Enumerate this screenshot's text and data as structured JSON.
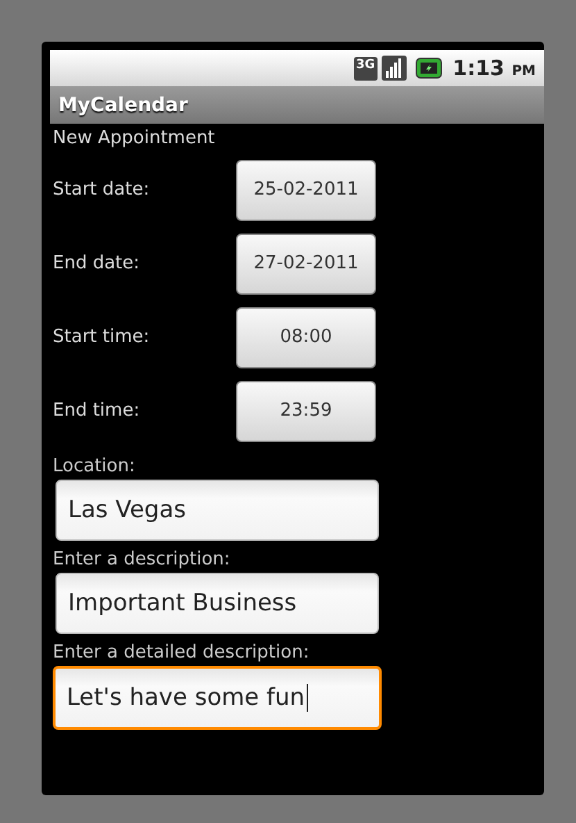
{
  "status_bar": {
    "network": "3G",
    "time": "1:13",
    "meridiem": "PM"
  },
  "app_title": "MyCalendar",
  "heading": "New Appointment",
  "pickers": [
    {
      "label": "Start date:",
      "value": "25-02-2011"
    },
    {
      "label": "End date:",
      "value": "27-02-2011"
    },
    {
      "label": "Start time:",
      "value": "08:00"
    },
    {
      "label": "End time:",
      "value": "23:59"
    }
  ],
  "fields": [
    {
      "label": "Location:",
      "value": "Las Vegas",
      "focused": false
    },
    {
      "label": "Enter a description:",
      "value": "Important Business",
      "focused": false
    },
    {
      "label": "Enter a detailed description:",
      "value": "Let's have some fun",
      "focused": true
    }
  ]
}
